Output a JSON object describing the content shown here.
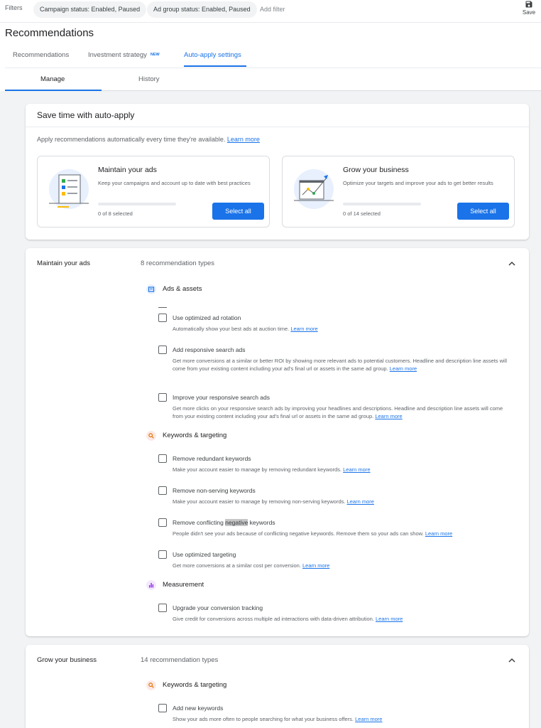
{
  "filters": {
    "label": "Filters",
    "chips": [
      "Campaign status: Enabled, Paused",
      "Ad group status: Enabled, Paused"
    ],
    "add_filter": "Add filter",
    "save_label": "Save"
  },
  "page_title": "Recommendations",
  "tabs": [
    {
      "label": "Recommendations",
      "active": false
    },
    {
      "label": "Investment strategy",
      "badge": "NEW",
      "active": false
    },
    {
      "label": "Auto-apply settings",
      "active": true
    }
  ],
  "subtabs": [
    {
      "label": "Manage",
      "active": true
    },
    {
      "label": "History",
      "active": false
    }
  ],
  "save_card": {
    "title": "Save time with auto-apply",
    "description": "Apply recommendations automatically every time they're available.",
    "learn_more": "Learn more",
    "boxes": [
      {
        "title": "Maintain your ads",
        "description": "Keep your campaigns and account up to date with best practices",
        "selected": "0 of 8 selected",
        "button": "Select all",
        "progress": 0
      },
      {
        "title": "Grow your business",
        "description": "Optimize your targets and improve your ads to get better results",
        "selected": "0 of 14 selected",
        "button": "Select all",
        "progress": 0
      }
    ]
  },
  "maintain": {
    "title": "Maintain your ads",
    "count": "8 recommendation types",
    "groups": [
      {
        "label": "Ads & assets",
        "icon": "ads-assets-icon"
      },
      {
        "label": "Keywords & targeting",
        "icon": "search-icon"
      },
      {
        "label": "Measurement",
        "icon": "bar-chart-icon"
      }
    ],
    "items": [
      {
        "title": "Use optimized ad rotation",
        "desc": "Automatically show your best ads at auction time.",
        "link": "Learn more",
        "checked": false
      },
      {
        "title": "Add responsive search ads",
        "desc": "Get more conversions at a similar or better ROI by showing more relevant ads to potential customers. Headline and description line assets will come from your existing content including your ad's final url or assets in the same ad group.",
        "link": "Learn more",
        "checked": false
      },
      {
        "title": "Improve your responsive search ads",
        "desc": "Get more clicks on your responsive search ads by improving your headlines and descriptions. Headline and description line assets will come from your existing content including your ad's final url or assets in the same ad group.",
        "link": "Learn more",
        "checked": false
      },
      {
        "title": "Remove redundant keywords",
        "desc": "Make your account easier to manage by removing redundant keywords.",
        "link": "Learn more",
        "checked": false
      },
      {
        "title": "Remove non-serving keywords",
        "desc": "Make your account easier to manage by removing non-serving keywords.",
        "link": "Learn more",
        "checked": false
      },
      {
        "title_pre": "Remove conflicting ",
        "title_hl": "negative",
        "title_post": " keywords",
        "desc": "People didn't see your ads because of conflicting negative keywords. Remove them so your ads can show.",
        "link": "Learn more",
        "checked": false
      },
      {
        "title": "Use optimized targeting",
        "desc": "Get more conversions at a similar cost per conversion.",
        "link": "Learn more",
        "checked": false
      },
      {
        "title": "Upgrade your conversion tracking",
        "desc": "Give credit for conversions across multiple ad interactions with data-driven attribution.",
        "link": "Learn more",
        "checked": false
      }
    ]
  },
  "grow": {
    "title": "Grow your business",
    "count": "14 recommendation types",
    "groups": [
      {
        "label": "Keywords & targeting",
        "icon": "search-icon"
      }
    ],
    "items": [
      {
        "title": "Add new keywords",
        "desc": "Show your ads more often to people searching for what your business offers.",
        "link": "Learn more",
        "checked": false
      }
    ]
  },
  "colors": {
    "accent": "#1a73e8",
    "text": "#3c4043",
    "muted": "#5f6368"
  }
}
